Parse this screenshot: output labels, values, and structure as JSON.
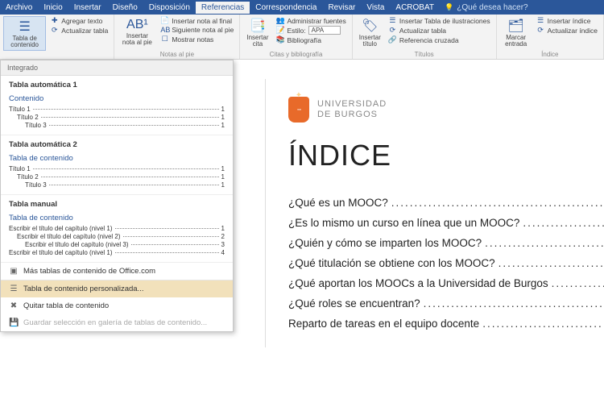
{
  "menu": {
    "items": [
      "Archivo",
      "Inicio",
      "Insertar",
      "Diseño",
      "Disposición",
      "Referencias",
      "Correspondencia",
      "Revisar",
      "Vista",
      "ACROBAT"
    ],
    "active": 5,
    "tellme": "¿Qué desea hacer?"
  },
  "ribbon": {
    "toc": {
      "btn": "Tabla de\ncontenido",
      "add": "Agregar texto",
      "upd": "Actualizar tabla"
    },
    "foot": {
      "insert": "Insertar\nnota al pie",
      "end": "Insertar nota al final",
      "next": "Siguiente nota al pie",
      "show": "Mostrar notas",
      "label": "Notas al pie"
    },
    "cite": {
      "insert": "Insertar\ncita",
      "admin": "Administrar fuentes",
      "style_lbl": "Estilo:",
      "style_val": "APA",
      "bib": "Bibliografía",
      "label": "Citas y bibliografía"
    },
    "cap": {
      "insert": "Insertar\ntítulo",
      "fig": "Insertar Tabla de ilustraciones",
      "upd": "Actualizar tabla",
      "cross": "Referencia cruzada",
      "label": "Títulos"
    },
    "idx": {
      "mark": "Marcar\nentrada",
      "insert": "Insertar índice",
      "upd": "Actualizar índice",
      "label": "Índice"
    }
  },
  "dropdown": {
    "hdr": "Integrado",
    "auto1": "Tabla automática 1",
    "auto2": "Tabla automática 2",
    "manual": "Tabla manual",
    "sub_contenido": "Contenido",
    "sub_tabla": "Tabla de contenido",
    "lines_auto": [
      {
        "name": "Título 1",
        "pg": "1",
        "lvl": 1
      },
      {
        "name": "Título 2",
        "pg": "1",
        "lvl": 2
      },
      {
        "name": "Título 3",
        "pg": "1",
        "lvl": 3
      }
    ],
    "lines_manual": [
      {
        "name": "Escribir el título del capítulo (nivel 1)",
        "pg": "1",
        "lvl": 1
      },
      {
        "name": "Escribir el título del capítulo (nivel 2)",
        "pg": "2",
        "lvl": 2
      },
      {
        "name": "Escribir el título del capítulo (nivel 3)",
        "pg": "3",
        "lvl": 3
      },
      {
        "name": "Escribir el título del capítulo (nivel 1)",
        "pg": "4",
        "lvl": 1
      }
    ],
    "more": "Más tablas de contenido de Office.com",
    "custom": "Tabla de contenido personalizada...",
    "remove": "Quitar tabla de contenido",
    "save": "Guardar selección en galería de tablas de contenido..."
  },
  "doc": {
    "uni1": "UNIVERSIDAD",
    "uni2": "DE BURGOS",
    "title": "ÍNDICE",
    "toc": [
      "¿Qué es un MOOC?",
      "¿Es lo mismo un curso en línea que un MOOC?",
      "¿Quién y cómo se imparten los MOOC?",
      "¿Qué titulación se obtiene con los MOOC?",
      "¿Qué aportan los MOOCs a la Universidad de Burgos",
      "¿Qué roles se encuentran?",
      "Reparto de tareas en el equipo docente"
    ]
  }
}
